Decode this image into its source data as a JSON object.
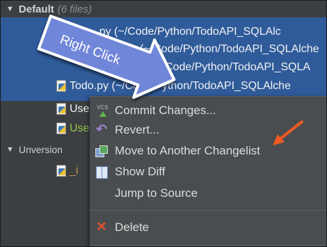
{
  "tree": {
    "group": {
      "label": "Default",
      "count": "(6 files)"
    },
    "files": [
      {
        "name": "init__.py (~/Code/Python/TodoAPI_SQLAlc"
      },
      {
        "name": "(~/Code/Python/TodoAPI_SQLAlche"
      },
      {
        "name": "Code/Python/TodoAPI_SQLA"
      },
      {
        "name": "Todo.py (~/Code/Python/TodoAPI_SQLAlche"
      },
      {
        "name": "Use"
      },
      {
        "name": "Use"
      }
    ],
    "unversioned": {
      "label": "Unversion",
      "file": "_i"
    }
  },
  "context_menu": {
    "vcs_badge": "VCS",
    "items": [
      {
        "label": "Commit Changes...",
        "icon": "commit-icon"
      },
      {
        "label": "Revert...",
        "icon": "revert-icon"
      },
      {
        "label": "Move to Another Changelist",
        "icon": "move-changelist-icon"
      },
      {
        "label": "Show Diff",
        "icon": "diff-icon"
      },
      {
        "label": "Jump to Source",
        "icon": "none"
      },
      {
        "label": "Delete",
        "icon": "delete-icon"
      }
    ]
  },
  "annotation": {
    "label": "Right Click",
    "arrow_color": "#6f86d8",
    "pointer_color": "#f05a22"
  },
  "colors": {
    "background": "#3c3f41",
    "selection": "#2f5b9a",
    "menu": "#4a4d4f"
  }
}
